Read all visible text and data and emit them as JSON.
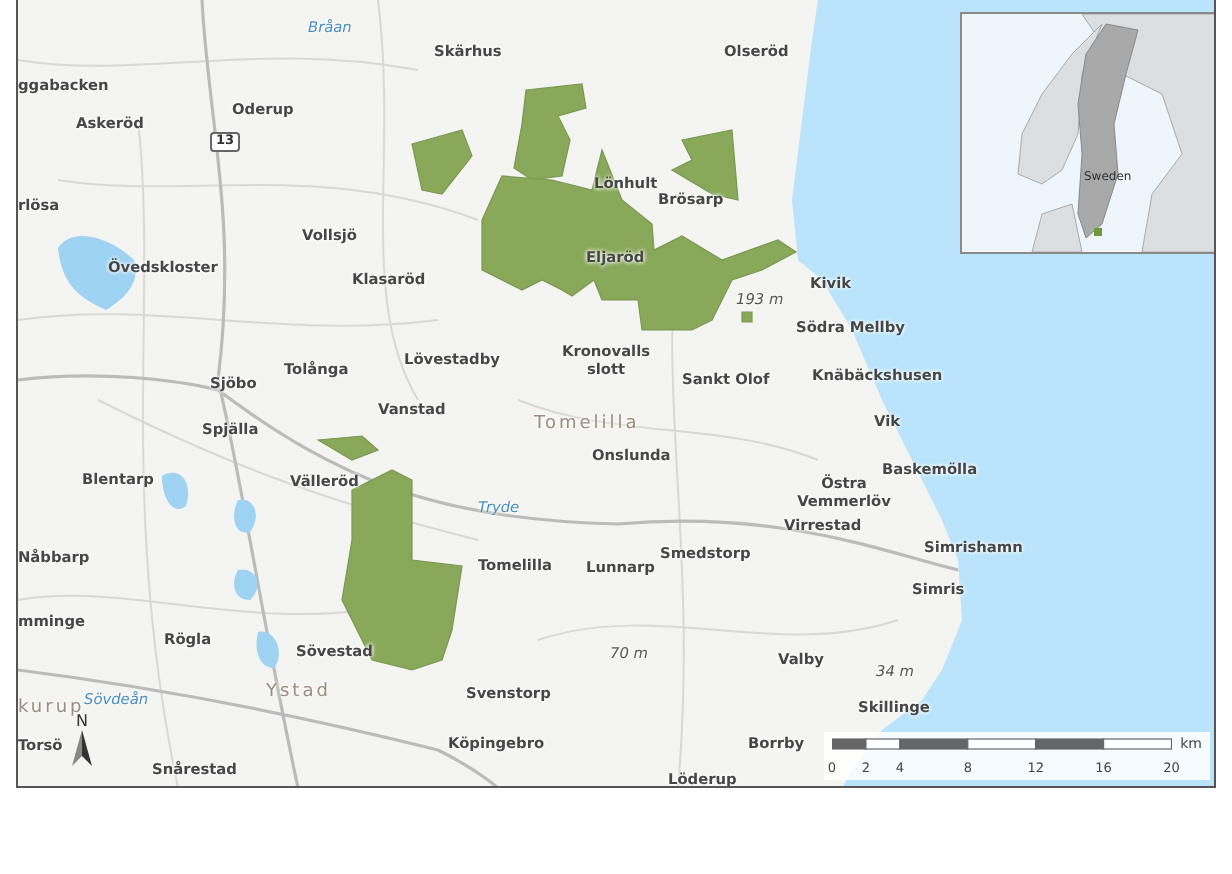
{
  "map": {
    "labels": [
      {
        "text": "Bråan",
        "kind": "river"
      },
      {
        "text": "Skärhus",
        "kind": "town"
      },
      {
        "text": "Olseröd",
        "kind": "town"
      },
      {
        "text": "ggabacken",
        "kind": "town"
      },
      {
        "text": "Oderup",
        "kind": "town"
      },
      {
        "text": "Askeröd",
        "kind": "town"
      },
      {
        "text": "13",
        "kind": "road"
      },
      {
        "text": "rlösa",
        "kind": "town"
      },
      {
        "text": "Lönhult",
        "kind": "town"
      },
      {
        "text": "Brösarp",
        "kind": "town"
      },
      {
        "text": "Vollsjö",
        "kind": "town"
      },
      {
        "text": "Eljaröd",
        "kind": "town"
      },
      {
        "text": "Övedskloster",
        "kind": "town"
      },
      {
        "text": "Klasaröd",
        "kind": "town"
      },
      {
        "text": "Kivik",
        "kind": "town"
      },
      {
        "text": "193 m",
        "kind": "elevation"
      },
      {
        "text": "Södra Mellby",
        "kind": "town"
      },
      {
        "text": "Tolånga",
        "kind": "town"
      },
      {
        "text": "Lövestadby",
        "kind": "town"
      },
      {
        "text": "Kronovalls slott",
        "kind": "town"
      },
      {
        "text": "Sankt Olof",
        "kind": "town"
      },
      {
        "text": "Knäbäckshusen",
        "kind": "town"
      },
      {
        "text": "Sjöbo",
        "kind": "town"
      },
      {
        "text": "Vanstad",
        "kind": "town"
      },
      {
        "text": "Tomelilla",
        "kind": "region"
      },
      {
        "text": "Vik",
        "kind": "town"
      },
      {
        "text": "Spjälla",
        "kind": "town"
      },
      {
        "text": "Onslunda",
        "kind": "town"
      },
      {
        "text": "Baskemölla",
        "kind": "town"
      },
      {
        "text": "Blentarp",
        "kind": "town"
      },
      {
        "text": "Välleröd",
        "kind": "town"
      },
      {
        "text": "Östra Vemmerlöv",
        "kind": "town"
      },
      {
        "text": "Tryde",
        "kind": "river"
      },
      {
        "text": "Virrestad",
        "kind": "town"
      },
      {
        "text": "Simrishamn",
        "kind": "town"
      },
      {
        "text": "Nåbbarp",
        "kind": "town"
      },
      {
        "text": "Tomelilla",
        "kind": "town"
      },
      {
        "text": "Lunnarp",
        "kind": "town"
      },
      {
        "text": "Smedstorp",
        "kind": "town"
      },
      {
        "text": "Simris",
        "kind": "town"
      },
      {
        "text": "mminge",
        "kind": "town"
      },
      {
        "text": "Rögla",
        "kind": "town"
      },
      {
        "text": "Sövestad",
        "kind": "town"
      },
      {
        "text": "70 m",
        "kind": "elevation"
      },
      {
        "text": "Valby",
        "kind": "town"
      },
      {
        "text": "34 m",
        "kind": "elevation"
      },
      {
        "text": "Ystad",
        "kind": "region"
      },
      {
        "text": "Svenstorp",
        "kind": "town"
      },
      {
        "text": "kurup",
        "kind": "region"
      },
      {
        "text": "Skillinge",
        "kind": "town"
      },
      {
        "text": "Sövdeån",
        "kind": "river"
      },
      {
        "text": "Torsö",
        "kind": "town"
      },
      {
        "text": "Köpingebro",
        "kind": "town"
      },
      {
        "text": "Borrby",
        "kind": "town"
      },
      {
        "text": "Snårestad",
        "kind": "town"
      },
      {
        "text": "Löderup",
        "kind": "town"
      }
    ],
    "north_arrow": {
      "label": "N"
    },
    "inset": {
      "label": "Sweden"
    },
    "scale_bar": {
      "unit": "km",
      "ticks": [
        "0",
        "2",
        "4",
        "8",
        "12",
        "16",
        "20"
      ]
    }
  }
}
